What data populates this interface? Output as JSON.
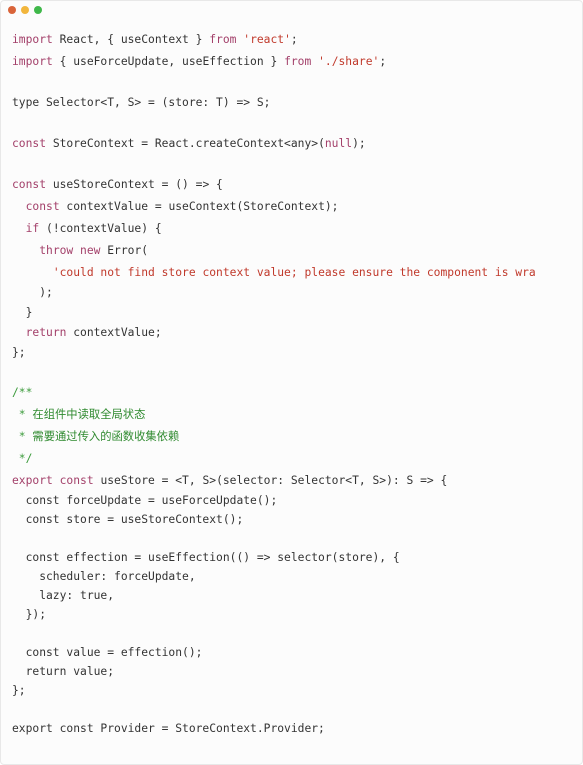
{
  "window": {
    "dots": [
      {
        "name": "close",
        "color": "#d9643a"
      },
      {
        "name": "minimize",
        "color": "#f2b63c"
      },
      {
        "name": "maximize",
        "color": "#3fb84a"
      }
    ]
  },
  "colors": {
    "keyword": "#a3406a",
    "string": "#c0392b",
    "comment": "#3a9a3a",
    "plain": "#333333"
  },
  "code": {
    "lines": [
      [
        {
          "t": "import",
          "c": "kw"
        },
        {
          "t": " React, { useContext } ",
          "c": "pl"
        },
        {
          "t": "from",
          "c": "kw"
        },
        {
          "t": " ",
          "c": "pl"
        },
        {
          "t": "'react'",
          "c": "str"
        },
        {
          "t": ";",
          "c": "pl"
        }
      ],
      [
        {
          "t": "import",
          "c": "kw"
        },
        {
          "t": " { useForceUpdate, useEffection } ",
          "c": "pl"
        },
        {
          "t": "from",
          "c": "kw"
        },
        {
          "t": " ",
          "c": "pl"
        },
        {
          "t": "'./share'",
          "c": "str"
        },
        {
          "t": ";",
          "c": "pl"
        }
      ],
      [],
      [
        {
          "t": "type Selector<T, S> = (store: T) => S;",
          "c": "pl"
        }
      ],
      [],
      [
        {
          "t": "const",
          "c": "kw"
        },
        {
          "t": " StoreContext = React.createContext<any>(",
          "c": "pl"
        },
        {
          "t": "null",
          "c": "kw"
        },
        {
          "t": ");",
          "c": "pl"
        }
      ],
      [],
      [
        {
          "t": "const",
          "c": "kw"
        },
        {
          "t": " useStoreContext = () => {",
          "c": "pl"
        }
      ],
      [
        {
          "t": "  ",
          "c": "pl"
        },
        {
          "t": "const",
          "c": "kw"
        },
        {
          "t": " contextValue = useContext(StoreContext);",
          "c": "pl"
        }
      ],
      [
        {
          "t": "  ",
          "c": "pl"
        },
        {
          "t": "if",
          "c": "kw"
        },
        {
          "t": " (!contextValue) {",
          "c": "pl"
        }
      ],
      [
        {
          "t": "    ",
          "c": "pl"
        },
        {
          "t": "throw",
          "c": "kw"
        },
        {
          "t": " ",
          "c": "pl"
        },
        {
          "t": "new",
          "c": "kw"
        },
        {
          "t": " Error(",
          "c": "pl"
        }
      ],
      [
        {
          "t": "      ",
          "c": "pl"
        },
        {
          "t": "'could not find store context value; please ensure the component is wra",
          "c": "str"
        }
      ],
      [
        {
          "t": "    );",
          "c": "pl"
        }
      ],
      [
        {
          "t": "  }",
          "c": "pl"
        }
      ],
      [
        {
          "t": "  ",
          "c": "pl"
        },
        {
          "t": "return",
          "c": "kw"
        },
        {
          "t": " contextValue;",
          "c": "pl"
        }
      ],
      [
        {
          "t": "};",
          "c": "pl"
        }
      ],
      [],
      [
        {
          "t": "/**",
          "c": "cmt"
        }
      ],
      [
        {
          "t": " * ",
          "c": "cmt"
        },
        {
          "t": "在组件中读取全局状态",
          "c": "cmt-cn"
        }
      ],
      [
        {
          "t": " * ",
          "c": "cmt"
        },
        {
          "t": "需要通过传入的函数收集依赖",
          "c": "cmt-cn"
        }
      ],
      [
        {
          "t": " */",
          "c": "cmt"
        }
      ],
      [
        {
          "t": "export",
          "c": "kw"
        },
        {
          "t": " ",
          "c": "pl"
        },
        {
          "t": "const",
          "c": "kw"
        },
        {
          "t": " useStore = <T, S>(selector: Selector<T, S>): S => {",
          "c": "pl"
        }
      ],
      [
        {
          "t": "  const forceUpdate = useForceUpdate();",
          "c": "pl"
        }
      ],
      [
        {
          "t": "  const store = useStoreContext();",
          "c": "pl"
        }
      ],
      [],
      [
        {
          "t": "  const effection = useEffection(() => selector(store), {",
          "c": "pl"
        }
      ],
      [
        {
          "t": "    scheduler: forceUpdate,",
          "c": "pl"
        }
      ],
      [
        {
          "t": "    lazy: true,",
          "c": "pl"
        }
      ],
      [
        {
          "t": "  });",
          "c": "pl"
        }
      ],
      [],
      [
        {
          "t": "  const value = effection();",
          "c": "pl"
        }
      ],
      [
        {
          "t": "  return value;",
          "c": "pl"
        }
      ],
      [
        {
          "t": "};",
          "c": "pl"
        }
      ],
      [],
      [
        {
          "t": "export const Provider = StoreContext.Provider;",
          "c": "pl"
        }
      ]
    ]
  }
}
